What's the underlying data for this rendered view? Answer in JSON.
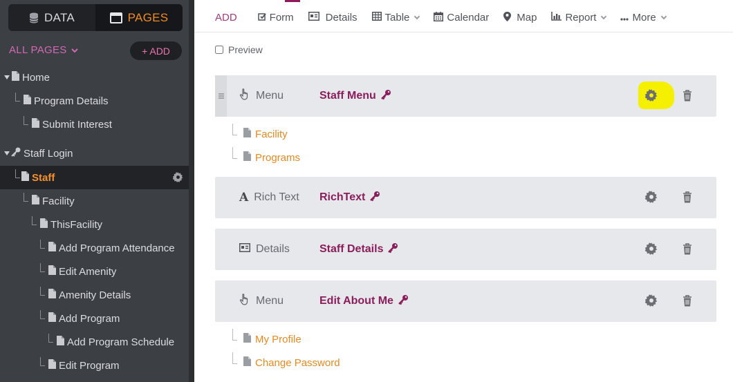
{
  "sidebar": {
    "tabs": [
      {
        "label": "DATA",
        "icon": "database-icon",
        "active": false
      },
      {
        "label": "PAGES",
        "icon": "window-icon",
        "active": true
      }
    ],
    "all_pages_label": "ALL PAGES",
    "add_label": "+ ADD",
    "pages": [
      {
        "label": "Home",
        "type": "folder-open",
        "selected": false
      },
      {
        "label": "Program Details",
        "type": "page",
        "selected": false
      },
      {
        "label": "Submit Interest",
        "type": "page",
        "selected": false
      },
      {
        "label": "Staff Login",
        "type": "login-open",
        "selected": false
      },
      {
        "label": "Staff",
        "type": "page",
        "selected": true
      },
      {
        "label": "Facility",
        "type": "page",
        "selected": false
      },
      {
        "label": "ThisFacility",
        "type": "page",
        "selected": false
      },
      {
        "label": "Add Program Attendance",
        "type": "page",
        "selected": false
      },
      {
        "label": "Edit Amenity",
        "type": "page",
        "selected": false
      },
      {
        "label": "Amenity Details",
        "type": "page",
        "selected": false
      },
      {
        "label": "Add Program",
        "type": "page",
        "selected": false
      },
      {
        "label": "Add Program Schedule",
        "type": "page",
        "selected": false
      },
      {
        "label": "Edit Program",
        "type": "page",
        "selected": false
      }
    ]
  },
  "toolbar": {
    "add_label": "ADD",
    "items": [
      {
        "label": "Form",
        "icon": "form-icon",
        "dropdown": false
      },
      {
        "label": "Details",
        "icon": "details-icon",
        "dropdown": false
      },
      {
        "label": "Table",
        "icon": "table-icon",
        "dropdown": true
      },
      {
        "label": "Calendar",
        "icon": "calendar-icon",
        "dropdown": false
      },
      {
        "label": "Map",
        "icon": "map-pin-icon",
        "dropdown": false
      },
      {
        "label": "Report",
        "icon": "bar-chart-icon",
        "dropdown": true
      },
      {
        "label": "More",
        "icon": "ellipsis-icon",
        "dropdown": true
      }
    ]
  },
  "preview": {
    "label": "Preview",
    "checked": false
  },
  "views": [
    {
      "type": "Menu",
      "type_icon": "pointer-hand-icon",
      "name": "Staff Menu",
      "locked": true,
      "highlighted": true,
      "links": [
        "Facility",
        "Programs"
      ]
    },
    {
      "type": "Rich Text",
      "type_icon": "rich-text-icon",
      "name": "RichText",
      "locked": true,
      "highlighted": false,
      "links": []
    },
    {
      "type": "Details",
      "type_icon": "details-icon",
      "name": "Staff Details",
      "locked": true,
      "highlighted": false,
      "links": []
    },
    {
      "type": "Menu",
      "type_icon": "pointer-hand-icon",
      "name": "Edit About Me",
      "locked": true,
      "highlighted": false,
      "links": [
        "My Profile",
        "Change Password"
      ]
    }
  ],
  "colors": {
    "sidebar_bg": "#3c3f44",
    "accent_orange": "#f28c1f",
    "accent_magenta": "#8a1d5b",
    "link_orange": "#e7891e",
    "card_bg": "#e7e8eb",
    "highlight_yellow": "#f5f000"
  }
}
